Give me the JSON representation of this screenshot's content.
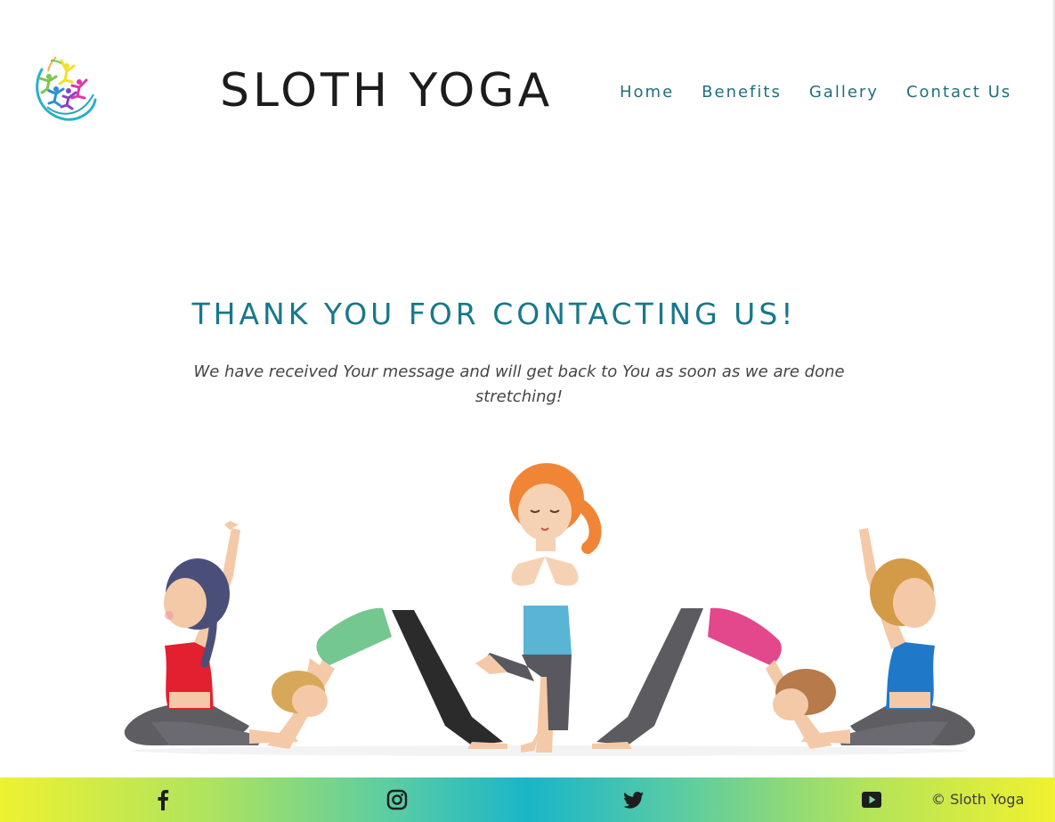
{
  "header": {
    "brand_title": "SLOTH YOGA",
    "logo_icon": "yoga-stars-logo",
    "nav": {
      "home": "Home",
      "benefits": "Benefits",
      "gallery": "Gallery",
      "contact": "Contact Us"
    }
  },
  "main": {
    "heading": "THANK YOU FOR CONTACTING US!",
    "message": "We have received Your message and will get back to You as soon as we are done stretching!",
    "illustration": "kids-doing-yoga-poses"
  },
  "footer": {
    "social": [
      "facebook-icon",
      "instagram-icon",
      "twitter-icon",
      "youtube-icon"
    ],
    "copyright": "© Sloth Yoga"
  },
  "colors": {
    "heading": "#17788a",
    "nav": "#1f6f7e",
    "footer_gradient": [
      "#eef131",
      "#1ab5c9",
      "#f1f12e"
    ]
  }
}
